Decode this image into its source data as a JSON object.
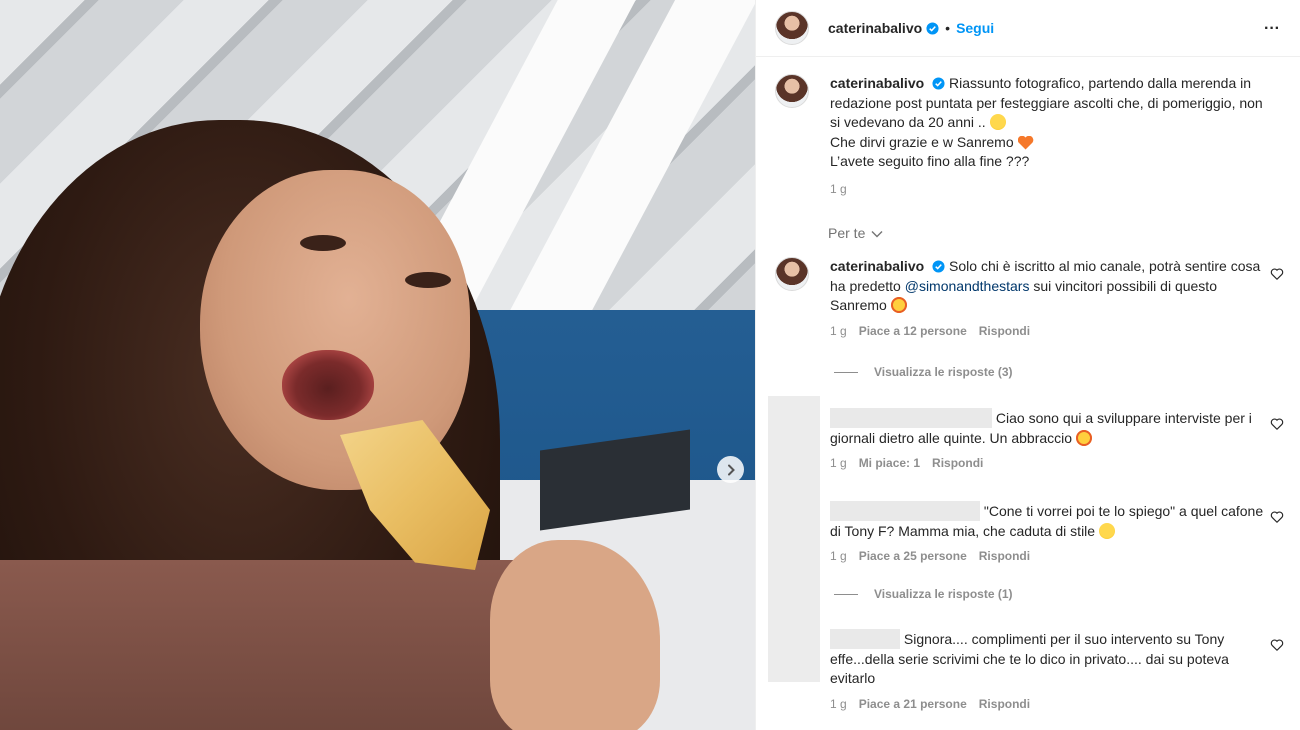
{
  "post": {
    "username": "caterinabalivo",
    "separator": "•",
    "follow_label": "Segui",
    "more_label": "···",
    "next_label": "Next"
  },
  "caption": {
    "username": "caterinabalivo",
    "line1": "Riassunto fotografico, partendo dalla merenda in redazione post puntata per festeggiare ascolti che, di pomeriggio, non si vedevano da 20 anni ..",
    "line2": "Che dirvi grazie e w Sanremo",
    "line3": "L’avete seguito fino alla fine ???",
    "time": "1 g"
  },
  "for_you_label": "Per te",
  "comments": [
    {
      "username": "caterinabalivo",
      "text_before": "Solo chi è iscritto al mio canale, potrà sentire cosa ha predetto",
      "mention": "@simonandthestars",
      "text_after": "sui vincitori possibili di questo Sanremo",
      "time": "1 g",
      "likes": "Piace a 12 persone",
      "reply": "Rispondi",
      "view_replies": "Visualizza le risposte (3)"
    },
    {
      "text": "Ciao sono qui a sviluppare interviste per i giornali dietro alle quinte. Un abbraccio",
      "time": "1 g",
      "likes": "Mi piace: 1",
      "reply": "Rispondi"
    },
    {
      "text": "\"Cone ti vorrei poi te lo spiego\" a quel cafone di Tony F? Mamma mia, che caduta di stile",
      "time": "1 g",
      "likes": "Piace a 25 persone",
      "reply": "Rispondi",
      "view_replies": "Visualizza le risposte (1)"
    },
    {
      "text": "Signora.... complimenti per il suo intervento su Tony effe...della serie scrivimi che te lo dico in privato.... dai su poteva evitarlo",
      "time": "1 g",
      "likes": "Piace a 21 persone",
      "reply": "Rispondi"
    }
  ]
}
